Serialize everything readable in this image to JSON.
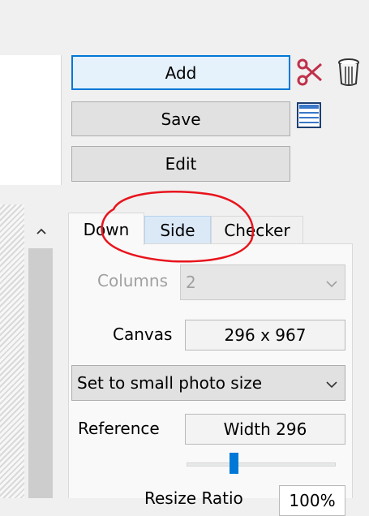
{
  "toolbar": {
    "add_label": "Add",
    "save_label": "Save",
    "edit_label": "Edit"
  },
  "icons": {
    "scissors": "scissors-icon",
    "trash": "trash-icon",
    "list": "list-icon",
    "scroll_up": "chevron-up-icon",
    "combo_arrow": "chevron-down-icon"
  },
  "tabs": [
    {
      "label": "Down",
      "active": true
    },
    {
      "label": "Side",
      "active": false,
      "hover": true
    },
    {
      "label": "Checker",
      "active": false
    }
  ],
  "panel": {
    "columns_label": "Columns",
    "columns_value": "2",
    "canvas_label": "Canvas",
    "canvas_value": "296 x 967",
    "size_select_value": "Set to small photo size",
    "reference_label": "Reference",
    "reference_value": "Width 296",
    "slider_level_fraction": 0.3,
    "partial_label": "Resize Ratio",
    "partial_value": "100%"
  },
  "colors": {
    "accent": "#0078d7",
    "annotation": "#e8141c",
    "scissors": "#c0304a"
  }
}
